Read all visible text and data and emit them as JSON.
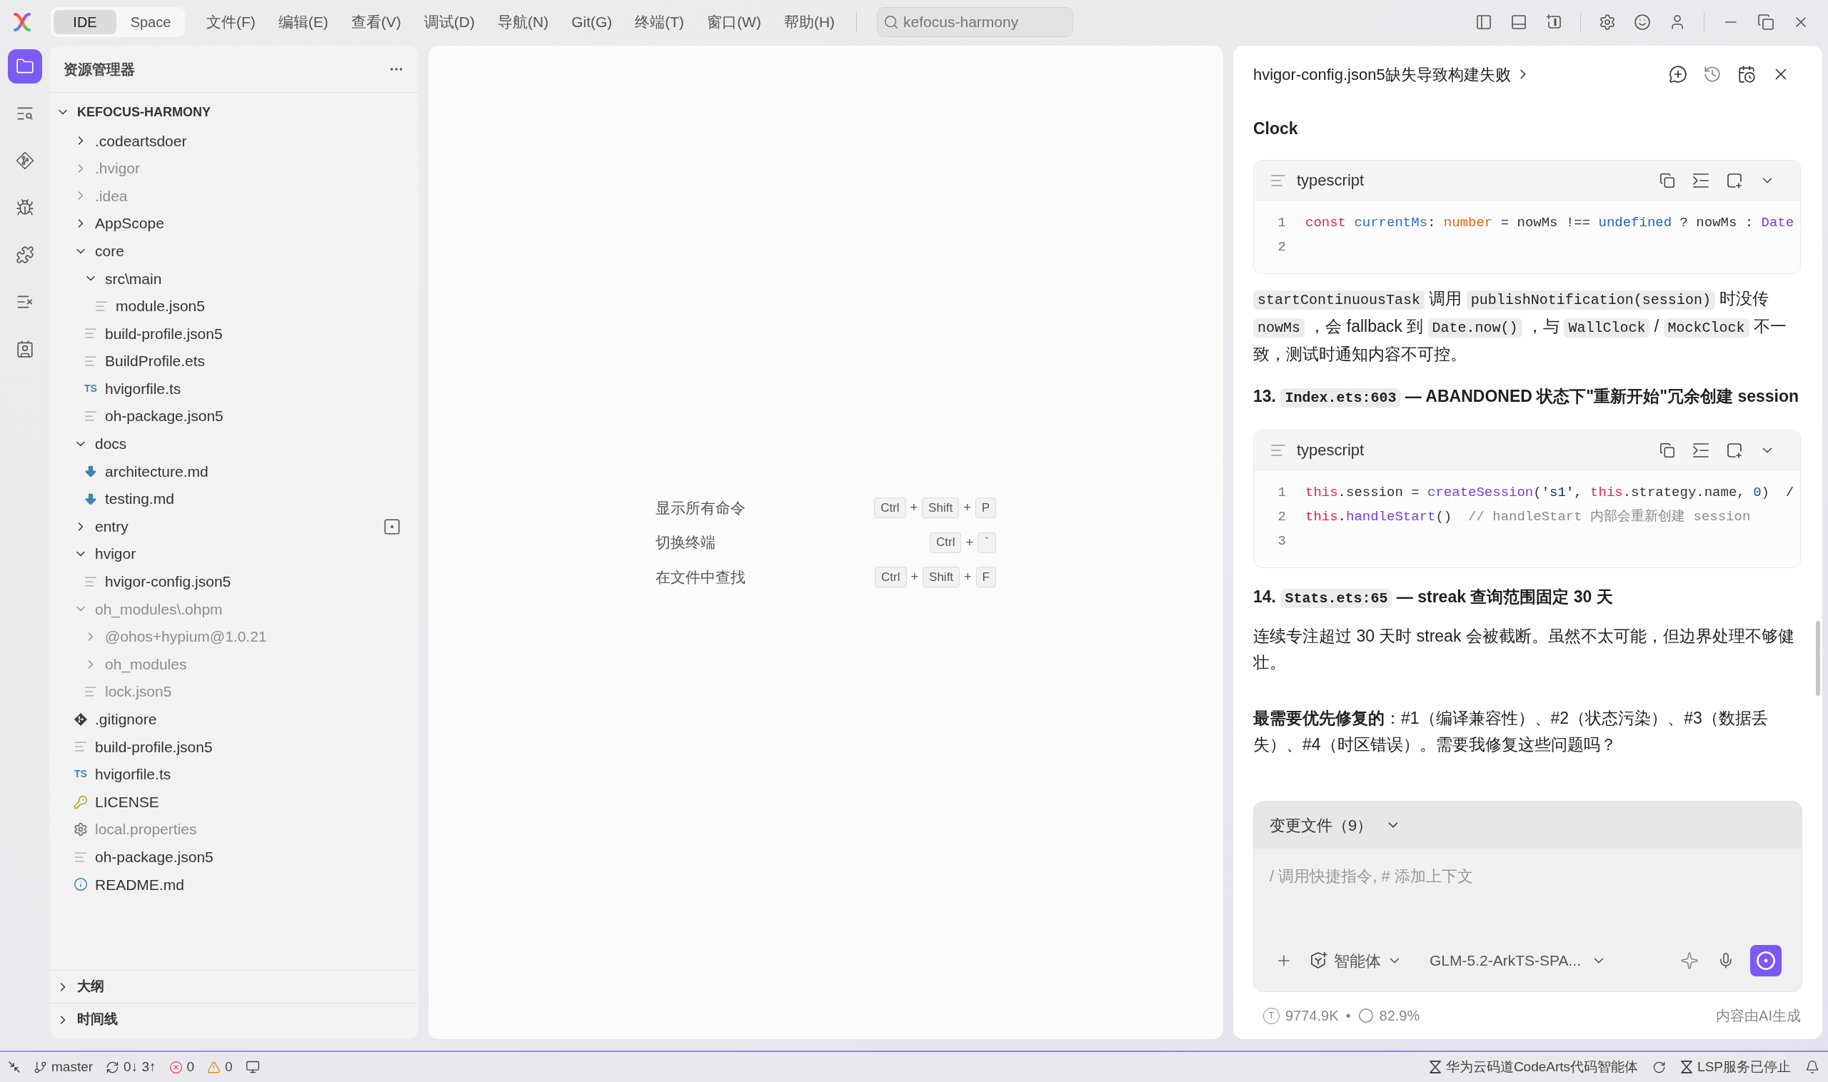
{
  "top_bar": {
    "mode_switch": [
      {
        "label": "IDE",
        "selected": true
      },
      {
        "label": "Space",
        "selected": false
      }
    ],
    "menus": [
      "文件(F)",
      "编辑(E)",
      "查看(V)",
      "调试(D)",
      "导航(N)",
      "Git(G)",
      "终端(T)",
      "窗口(W)",
      "帮助(H)"
    ],
    "search": {
      "placeholder": "kefocus-harmony"
    }
  },
  "activity_bar": [
    {
      "kind": "explorer",
      "selected": true
    },
    {
      "kind": "search",
      "selected": false
    },
    {
      "kind": "source_control",
      "selected": false
    },
    {
      "kind": "debug",
      "selected": false
    },
    {
      "kind": "extensions",
      "selected": false
    },
    {
      "kind": "tasks",
      "selected": false
    },
    {
      "kind": "profile",
      "selected": false
    }
  ],
  "explorer": {
    "title": "资源管理器",
    "tree": {
      "label": "KEFOCUS-HARMONY",
      "kind": "folder",
      "expanded": true,
      "dimmed": false,
      "marked": false,
      "children": [
        {
          "label": ".codeartsdoer",
          "kind": "folder",
          "expanded": false,
          "dimmed": false,
          "marked": false
        },
        {
          "label": ".hvigor",
          "kind": "folder",
          "expanded": false,
          "dimmed": true,
          "marked": false
        },
        {
          "label": ".idea",
          "kind": "folder",
          "expanded": false,
          "dimmed": true,
          "marked": false
        },
        {
          "label": "AppScope",
          "kind": "folder",
          "expanded": false,
          "dimmed": false,
          "marked": false
        },
        {
          "label": "core",
          "kind": "folder",
          "expanded": true,
          "dimmed": false,
          "marked": false,
          "children": [
            {
              "label": "src\\main",
              "kind": "folder",
              "expanded": true,
              "dimmed": false,
              "marked": false,
              "children": [
                {
                  "label": "module.json5",
                  "kind": "text",
                  "dimmed": false,
                  "marked": false
                }
              ]
            },
            {
              "label": "build-profile.json5",
              "kind": "text",
              "dimmed": false,
              "marked": false
            },
            {
              "label": "BuildProfile.ets",
              "kind": "text",
              "dimmed": false,
              "marked": false
            },
            {
              "label": "hvigorfile.ts",
              "kind": "typescript",
              "badge": "TS",
              "dimmed": false,
              "marked": false
            },
            {
              "label": "oh-package.json5",
              "kind": "text",
              "dimmed": false,
              "marked": false
            }
          ]
        },
        {
          "label": "docs",
          "kind": "folder",
          "expanded": true,
          "dimmed": false,
          "marked": false,
          "children": [
            {
              "label": "architecture.md",
              "kind": "markdown",
              "dimmed": false,
              "marked": false
            },
            {
              "label": "testing.md",
              "kind": "markdown",
              "dimmed": false,
              "marked": false
            }
          ]
        },
        {
          "label": "entry",
          "kind": "folder",
          "expanded": false,
          "dimmed": false,
          "marked": true
        },
        {
          "label": "hvigor",
          "kind": "folder",
          "expanded": true,
          "dimmed": false,
          "marked": false,
          "children": [
            {
              "label": "hvigor-config.json5",
              "kind": "text",
              "dimmed": false,
              "marked": false
            }
          ]
        },
        {
          "label": "oh_modules\\.ohpm",
          "kind": "folder",
          "expanded": true,
          "dimmed": true,
          "marked": false,
          "children": [
            {
              "label": "@ohos+hypium@1.0.21",
              "kind": "folder",
              "expanded": false,
              "dimmed": true,
              "marked": false
            },
            {
              "label": "oh_modules",
              "kind": "folder",
              "expanded": false,
              "dimmed": true,
              "marked": false
            },
            {
              "label": "lock.json5",
              "kind": "text",
              "dimmed": true,
              "marked": false
            }
          ]
        },
        {
          "label": ".gitignore",
          "kind": "git",
          "dimmed": false,
          "marked": false
        },
        {
          "label": "build-profile.json5",
          "kind": "text",
          "dimmed": false,
          "marked": false
        },
        {
          "label": "hvigorfile.ts",
          "kind": "typescript",
          "badge": "TS",
          "dimmed": false,
          "marked": false
        },
        {
          "label": "LICENSE",
          "kind": "license",
          "dimmed": false,
          "marked": false
        },
        {
          "label": "local.properties",
          "kind": "properties",
          "dimmed": true,
          "marked": false
        },
        {
          "label": "oh-package.json5",
          "kind": "text",
          "dimmed": false,
          "marked": false
        },
        {
          "label": "README.md",
          "kind": "readme",
          "dimmed": false,
          "marked": false
        }
      ]
    },
    "sections": [
      {
        "label": "大纲",
        "expanded": false
      },
      {
        "label": "时间线",
        "expanded": false
      }
    ]
  },
  "editor": {
    "commands": [
      {
        "label": "显示所有命令",
        "keys": [
          {
            "kind": "key",
            "text": "Ctrl"
          },
          {
            "kind": "plus",
            "text": "+"
          },
          {
            "kind": "key",
            "text": "Shift"
          },
          {
            "kind": "plus",
            "text": "+"
          },
          {
            "kind": "key",
            "text": "P"
          }
        ]
      },
      {
        "label": "切换终端",
        "keys": [
          {
            "kind": "key",
            "text": "Ctrl"
          },
          {
            "kind": "plus",
            "text": "+"
          },
          {
            "kind": "key",
            "text": "`"
          }
        ]
      },
      {
        "label": "在文件中查找",
        "keys": [
          {
            "kind": "key",
            "text": "Ctrl"
          },
          {
            "kind": "plus",
            "text": "+"
          },
          {
            "kind": "key",
            "text": "Shift"
          },
          {
            "kind": "plus",
            "text": "+"
          },
          {
            "kind": "key",
            "text": "F"
          }
        ]
      }
    ]
  },
  "chat": {
    "title": "hvigor-config.json5缺失导致构建失败",
    "blocks": [
      {
        "kind": "heading_tail",
        "text": "Clock"
      },
      {
        "kind": "code",
        "language": "typescript",
        "lines": [
          {
            "number": "1",
            "tokens": [
              {
                "kind": "keyword",
                "text": "const"
              },
              {
                "kind": "variable",
                "text": " currentMs"
              },
              {
                "kind": "plain",
                "text": ": "
              },
              {
                "kind": "type",
                "text": "number"
              },
              {
                "kind": "plain",
                "text": " = nowMs !== "
              },
              {
                "kind": "constant",
                "text": "undefined"
              },
              {
                "kind": "plain",
                "text": " ? nowMs : "
              },
              {
                "kind": "class",
                "text": "Date"
              }
            ]
          },
          {
            "number": "2"
          }
        ]
      },
      {
        "kind": "paragraph",
        "parts": [
          {
            "kind": "code",
            "text": "startContinuousTask"
          },
          {
            "kind": "text",
            "text": " 调用 "
          },
          {
            "kind": "code",
            "text": "publishNotification(session)"
          },
          {
            "kind": "text",
            "text": " 时没传 "
          },
          {
            "kind": "code",
            "text": "nowMs"
          },
          {
            "kind": "text",
            "text": " ，会 fallback 到 "
          },
          {
            "kind": "code",
            "text": "Date.now()"
          },
          {
            "kind": "text",
            "text": " ，与 "
          },
          {
            "kind": "code",
            "text": "WallClock"
          },
          {
            "kind": "text",
            "text": " / "
          },
          {
            "kind": "code",
            "text": "MockClock"
          },
          {
            "kind": "text",
            "text": " 不一致，测试时通知内容不可控。"
          }
        ]
      },
      {
        "kind": "heading",
        "parts": [
          {
            "kind": "text",
            "text": "13. "
          },
          {
            "kind": "code",
            "text": "Index.ets:603"
          },
          {
            "kind": "text",
            "text": " — ABANDONED 状态下\"重新开始\"冗余创建 session"
          }
        ]
      },
      {
        "kind": "code",
        "language": "typescript",
        "lines": [
          {
            "number": "1",
            "tokens": [
              {
                "kind": "keyword",
                "text": "this"
              },
              {
                "kind": "plain",
                "text": ".session = "
              },
              {
                "kind": "function",
                "text": "createSession"
              },
              {
                "kind": "plain",
                "text": "("
              },
              {
                "kind": "string",
                "text": "'s1'"
              },
              {
                "kind": "plain",
                "text": ", "
              },
              {
                "kind": "keyword",
                "text": "this"
              },
              {
                "kind": "plain",
                "text": ".strategy.name, "
              },
              {
                "kind": "number",
                "text": "0"
              },
              {
                "kind": "plain",
                "text": ")  /"
              }
            ]
          },
          {
            "number": "2",
            "tokens": [
              {
                "kind": "keyword",
                "text": "this"
              },
              {
                "kind": "plain",
                "text": "."
              },
              {
                "kind": "function",
                "text": "handleStart"
              },
              {
                "kind": "plain",
                "text": "()  "
              },
              {
                "kind": "comment",
                "text": "// handleStart 内部会重新创建 session"
              }
            ]
          },
          {
            "number": "3"
          }
        ]
      },
      {
        "kind": "heading",
        "parts": [
          {
            "kind": "text",
            "text": "14. "
          },
          {
            "kind": "code",
            "text": "Stats.ets:65"
          },
          {
            "kind": "text",
            "text": " — streak 查询范围固定 30 天"
          }
        ]
      },
      {
        "kind": "paragraph",
        "parts": [
          {
            "kind": "text",
            "text": "连续专注超过 30 天时 streak 会被截断。虽然不太可能，但边界处理不够健壮。"
          }
        ]
      },
      {
        "kind": "paragraph",
        "parts": [
          {
            "kind": "text",
            "text": "**最需要优先修复的**：#1（编译兼容性）、#2（状态污染）、#3（数据丢失）、#4（时区错误）。需要我修复这些问题吗？"
          }
        ]
      }
    ],
    "changed_files": {
      "label": "变更文件（9）",
      "expanded": false
    },
    "input": {
      "placeholder": "/ 调用快捷指令, # 添加上下文"
    },
    "agent": {
      "label": "智能体"
    },
    "model": {
      "label": "GLM-5.2-ArkTS-SPA..."
    },
    "footer": {
      "token_badge": "T",
      "tokens": "9774.9K",
      "separator": "•",
      "context": "82.9%",
      "note": "内容由AI生成"
    }
  },
  "status_bar": {
    "left": [
      {
        "kind": "remote"
      },
      {
        "kind": "branch",
        "text": "master"
      },
      {
        "kind": "sync",
        "text": "0↓ 3↑"
      },
      {
        "kind": "errors",
        "text": "0"
      },
      {
        "kind": "warnings",
        "text": "0"
      },
      {
        "kind": "monitor"
      }
    ],
    "right": [
      {
        "kind": "agent",
        "text": "华为云码道CodeArts代码智能体"
      },
      {
        "kind": "refresh"
      },
      {
        "kind": "lsp",
        "text": "LSP服务已停止"
      },
      {
        "kind": "notifications"
      }
    ]
  }
}
